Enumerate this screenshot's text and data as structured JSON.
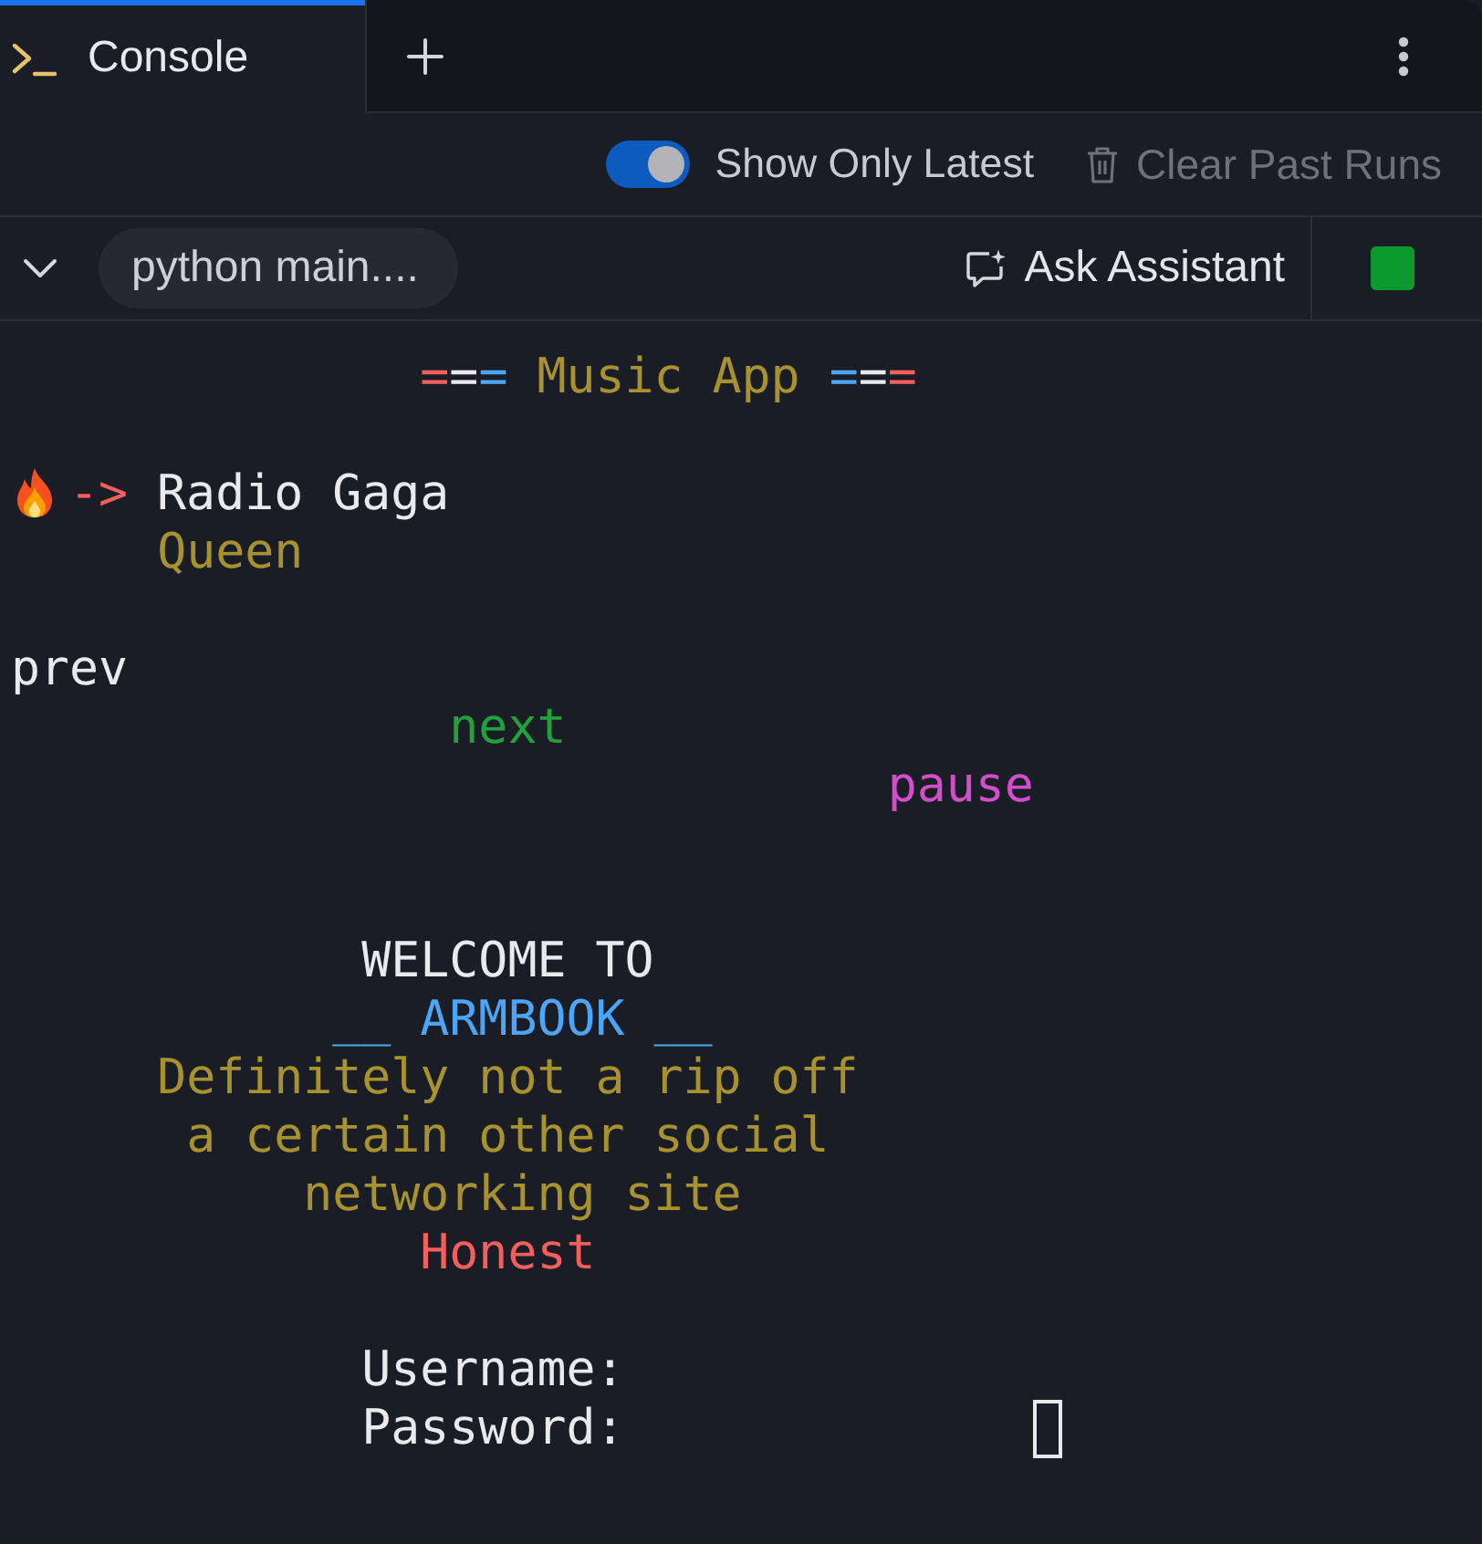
{
  "tabs": [
    {
      "label": "Console",
      "selected": true
    }
  ],
  "toolbar": {
    "show_only_latest": {
      "label": "Show Only Latest",
      "on": true
    },
    "clear_past_runs": {
      "label": "Clear Past Runs",
      "disabled": true
    }
  },
  "run_bar": {
    "expanded": true,
    "command": "python main....",
    "ask_assistant": "Ask Assistant"
  },
  "console": {
    "lines": [
      {
        "kind": "text",
        "segments": [
          {
            "kind": "rule",
            "parts": [
              {
                "text": "              =",
                "color": "#f25f5c"
              },
              {
                "text": "=",
                "color": "#e9e9ee"
              },
              {
                "text": "=",
                "color": "#4ba6f7"
              }
            ]
          },
          {
            "kind": "text",
            "text": " Music App",
            "color": "#a8922e"
          },
          {
            "kind": "rule",
            "parts": [
              {
                "text": " =",
                "color": "#4ba6f7"
              },
              {
                "text": "=",
                "color": "#e9e9ee"
              },
              {
                "text": "=",
                "color": "#f25f5c"
              }
            ]
          }
        ]
      },
      {
        "kind": "blank"
      },
      {
        "kind": "text",
        "segments": [
          {
            "kind": "icon"
          },
          {
            "kind": "text",
            "text": "->",
            "color": "#f25f5c"
          },
          {
            "kind": "text",
            "text": " Radio Gaga",
            "color": "#e9e9ee"
          }
        ]
      },
      {
        "kind": "text",
        "segments": [
          {
            "kind": "text",
            "text": "     Queen",
            "color": "#a8922e"
          }
        ]
      },
      {
        "kind": "blank"
      },
      {
        "kind": "text",
        "segments": [
          {
            "kind": "text",
            "text": "prev",
            "color": "#e9e9ee"
          }
        ]
      },
      {
        "kind": "text",
        "segments": [
          {
            "kind": "text",
            "text": "               next",
            "color": "#22a03c"
          }
        ]
      },
      {
        "kind": "text",
        "segments": [
          {
            "kind": "text",
            "text": "                              pause",
            "color": "#d14fc9"
          }
        ]
      },
      {
        "kind": "blank"
      },
      {
        "kind": "blank"
      },
      {
        "kind": "text",
        "segments": [
          {
            "kind": "text",
            "text": "            WELCOME TO",
            "color": "#e9e9ee"
          }
        ]
      },
      {
        "kind": "text",
        "segments": [
          {
            "kind": "text",
            "text": "           __ ARMBOOK __",
            "color": "#4ba6f7"
          }
        ]
      },
      {
        "kind": "text",
        "segments": [
          {
            "kind": "text",
            "text": "     Definitely not a rip off",
            "color": "#a8922e"
          }
        ]
      },
      {
        "kind": "text",
        "segments": [
          {
            "kind": "text",
            "text": "      a certain other social",
            "color": "#a8922e"
          }
        ]
      },
      {
        "kind": "text",
        "segments": [
          {
            "kind": "text",
            "text": "          networking site",
            "color": "#a8922e"
          }
        ]
      },
      {
        "kind": "text",
        "segments": [
          {
            "kind": "text",
            "text": "              Honest",
            "color": "#f25f5c"
          }
        ]
      },
      {
        "kind": "blank"
      },
      {
        "kind": "text",
        "segments": [
          {
            "kind": "text",
            "text": "            Username:",
            "color": "#e9e9ee"
          }
        ]
      },
      {
        "kind": "text",
        "segments": [
          {
            "kind": "text",
            "text": "            Password:",
            "color": "#e9e9ee"
          },
          {
            "kind": "cursor"
          }
        ]
      }
    ]
  }
}
